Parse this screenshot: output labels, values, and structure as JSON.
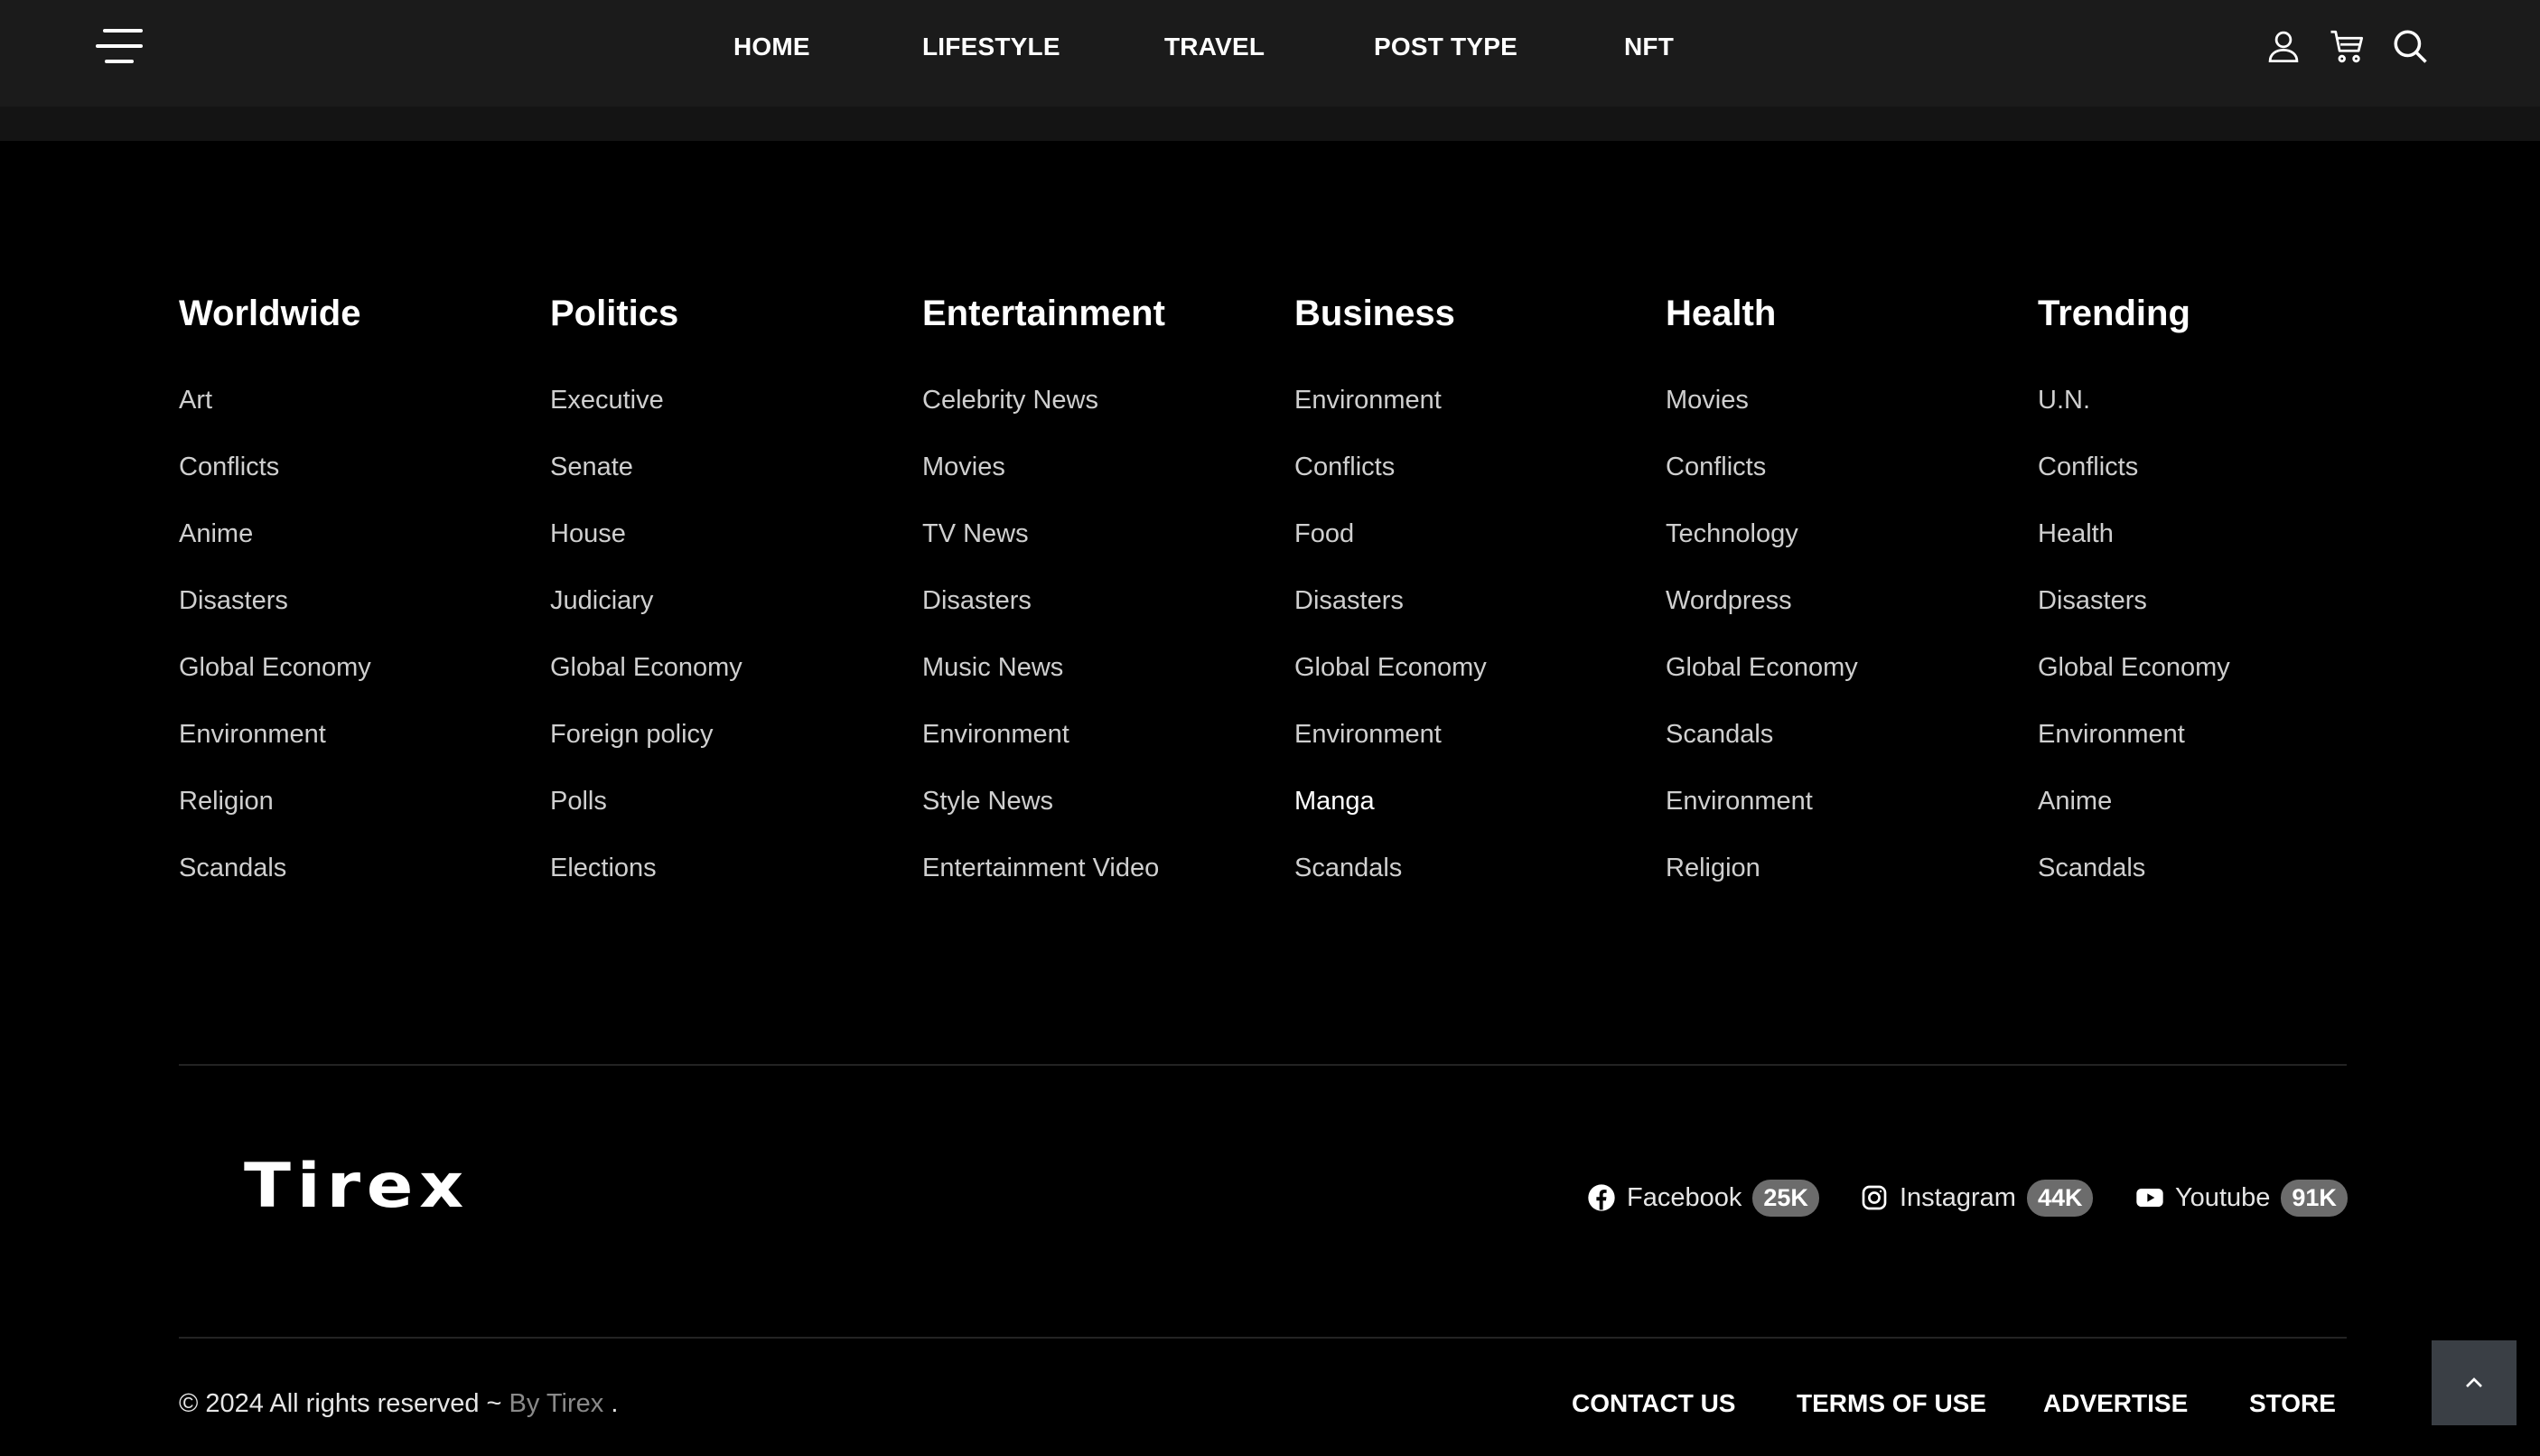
{
  "nav": {
    "links": [
      "HOME",
      "LIFESTYLE",
      "TRAVEL",
      "POST TYPE",
      "NFT"
    ],
    "icons": [
      "user-icon",
      "cart-icon",
      "search-icon"
    ]
  },
  "columns": [
    {
      "title": "Worldwide",
      "items": [
        "Art",
        "Conflicts",
        "Anime",
        "Disasters",
        "Global Economy",
        "Environment",
        "Religion",
        "Scandals"
      ]
    },
    {
      "title": "Politics",
      "items": [
        "Executive",
        "Senate",
        "House",
        "Judiciary",
        "Global Economy",
        "Foreign policy",
        "Polls",
        "Elections"
      ]
    },
    {
      "title": "Entertainment",
      "items": [
        "Celebrity News",
        "Movies",
        "TV News",
        "Disasters",
        "Music News",
        "Environment",
        "Style News",
        "Entertainment Video"
      ]
    },
    {
      "title": "Business",
      "items": [
        "Environment",
        "Conflicts",
        "Food",
        "Disasters",
        "Global Economy",
        "Environment",
        "Manga",
        "Scandals"
      ]
    },
    {
      "title": "Health",
      "items": [
        "Movies",
        "Conflicts",
        "Technology",
        "Wordpress",
        "Global Economy",
        "Scandals",
        "Environment",
        "Religion"
      ]
    },
    {
      "title": "Trending",
      "items": [
        "U.N.",
        "Conflicts",
        "Health",
        "Disasters",
        "Global Economy",
        "Environment",
        "Anime",
        "Scandals"
      ]
    }
  ],
  "brand": {
    "logo": "Tirex"
  },
  "social": [
    {
      "label": "Facebook",
      "count": "25K",
      "icon": "facebook-icon"
    },
    {
      "label": "Instagram",
      "count": "44K",
      "icon": "instagram-icon"
    },
    {
      "label": "Youtube",
      "count": "91K",
      "icon": "youtube-icon"
    }
  ],
  "footer": {
    "copyright": "© 2024 All rights reserved ~ ",
    "by": "By Tirex",
    "period": " .",
    "links": [
      "CONTACT US",
      "TERMS OF USE",
      "ADVERTISE",
      "STORE"
    ]
  },
  "colors": {
    "page_bg": "#000000",
    "topbar_bg": "#1b1b1b",
    "link_text": "#cfcfcf",
    "badge_bg": "#6c6c6c",
    "to_top_bg": "#3a3f45"
  }
}
